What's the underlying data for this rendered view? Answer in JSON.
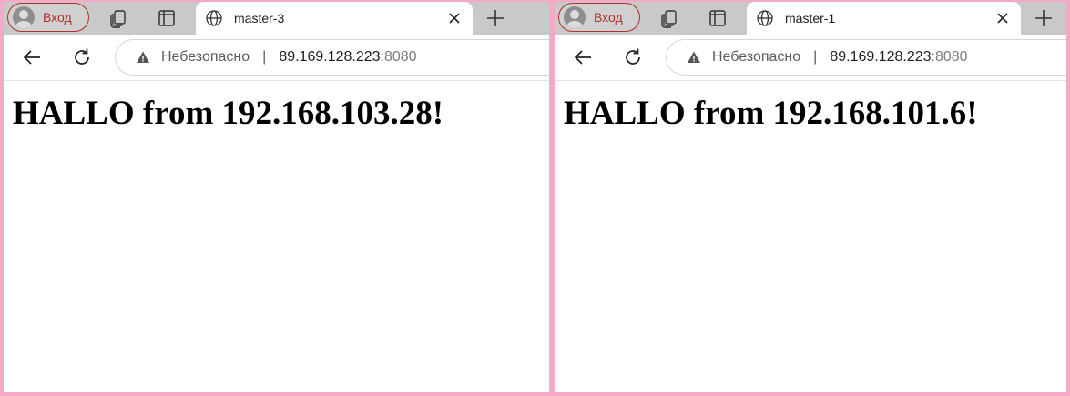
{
  "windows": [
    {
      "profile_label": "Вход",
      "tab_title": "master-3",
      "security_label": "Небезопасно",
      "url_host": "89.169.128.223",
      "url_port": ":8080",
      "heading": "HALLO from 192.168.103.28!"
    },
    {
      "profile_label": "Вход",
      "tab_title": "master-1",
      "security_label": "Небезопасно",
      "url_host": "89.169.128.223",
      "url_port": ":8080",
      "heading": "HALLO from 192.168.101.6!"
    }
  ],
  "icons": [
    "profile-avatar-icon",
    "workspaces-icon",
    "tab-actions-icon",
    "globe-icon",
    "close-icon",
    "new-tab-icon",
    "back-arrow-icon",
    "refresh-icon",
    "warning-icon"
  ],
  "colors": {
    "frame": "#f4a9c6",
    "tabbar": "#c9c9c9",
    "profile_accent": "#b0302a"
  }
}
